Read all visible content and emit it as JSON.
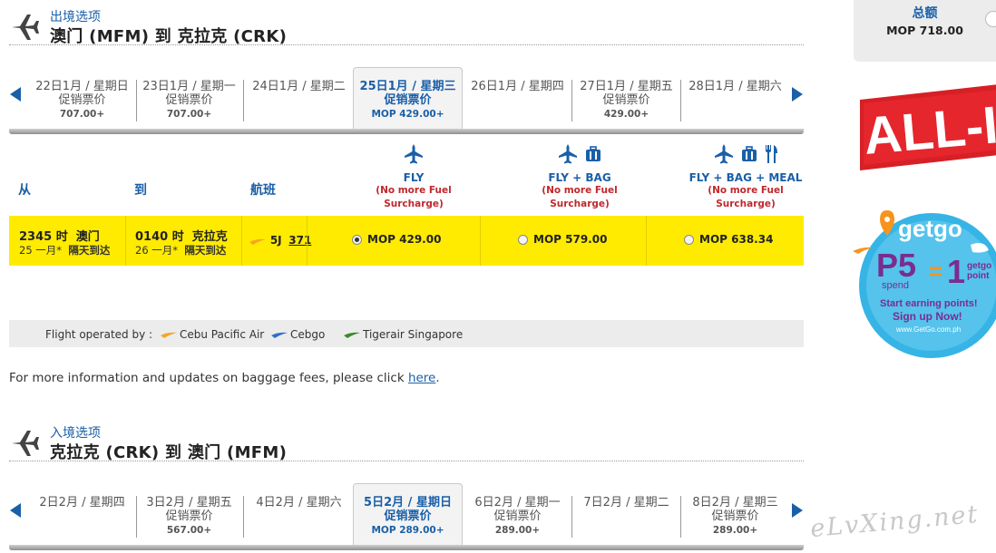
{
  "outbound": {
    "kicker": "出境选项",
    "route": "澳门 (MFM) 到 克拉克 (CRK)",
    "days": [
      {
        "date": "22日1月 / 星期日",
        "label": "促销票价",
        "price": "707.00+"
      },
      {
        "date": "23日1月 / 星期一",
        "label": "促销票价",
        "price": "707.00+"
      },
      {
        "date": "24日1月 / 星期二",
        "label": "",
        "price": ""
      },
      {
        "date": "25日1月 / 星期三",
        "label": "促销票价",
        "price": "MOP 429.00+"
      },
      {
        "date": "26日1月 / 星期四",
        "label": "",
        "price": ""
      },
      {
        "date": "27日1月 / 星期五",
        "label": "促销票价",
        "price": "429.00+"
      },
      {
        "date": "28日1月 / 星期六",
        "label": "",
        "price": ""
      }
    ]
  },
  "columns": {
    "from": "从",
    "to": "到",
    "flight": "航班",
    "fares": [
      {
        "name": "FLY",
        "note1": "(No more Fuel",
        "note2": "Surcharge)"
      },
      {
        "name": "FLY + BAG",
        "note1": "(No more Fuel",
        "note2": "Surcharge)"
      },
      {
        "name": "FLY + BAG + MEAL",
        "note1": "(No more Fuel",
        "note2": "Surcharge)"
      }
    ]
  },
  "flight": {
    "dep_time": "2345 时",
    "dep_city": "澳门",
    "dep_date": "25 一月*",
    "dep_arrival_note": "隔天到达",
    "arr_time": "0140 时",
    "arr_city": "克拉克",
    "arr_date": "26 一月*",
    "arr_arrival_note": "隔天到达",
    "code": "5J",
    "number": "371",
    "fares": [
      {
        "price": "MOP 429.00",
        "selected": true
      },
      {
        "price": "MOP 579.00",
        "selected": false
      },
      {
        "price": "MOP 638.34",
        "selected": false
      }
    ]
  },
  "operators": {
    "label": "Flight operated by :",
    "list": [
      {
        "name": "Cebu Pacific Air",
        "color": "#f5a623"
      },
      {
        "name": "Cebgo",
        "color": "#2f6fce"
      },
      {
        "name": "Tigerair Singapore",
        "color": "#3a8a2a"
      }
    ]
  },
  "info": {
    "text": "For more information and updates on baggage fees, please click ",
    "link": "here",
    "suffix": "."
  },
  "inbound": {
    "kicker": "入境选项",
    "route": "克拉克 (CRK) 到 澳门 (MFM)",
    "days": [
      {
        "date": "2日2月 / 星期四",
        "label": "",
        "price": ""
      },
      {
        "date": "3日2月 / 星期五",
        "label": "促销票价",
        "price": "567.00+"
      },
      {
        "date": "4日2月 / 星期六",
        "label": "",
        "price": ""
      },
      {
        "date": "5日2月 / 星期日",
        "label": "促销票价",
        "price": "MOP 289.00+"
      },
      {
        "date": "6日2月 / 星期一",
        "label": "促销票价",
        "price": "289.00+"
      },
      {
        "date": "7日2月 / 星期二",
        "label": "",
        "price": ""
      },
      {
        "date": "8日2月 / 星期三",
        "label": "促销票价",
        "price": "289.00+"
      }
    ]
  },
  "total": {
    "title": "总额",
    "value": "MOP  718.00"
  },
  "ads": {
    "allin": "ALL-IN",
    "getgo_brand": "getgo",
    "getgo_p5": "P5",
    "getgo_spend": "spend",
    "getgo_eq": "=",
    "getgo_one": "1",
    "getgo_unit1": "getgo",
    "getgo_unit2": "point",
    "getgo_line1": "Start earning points!",
    "getgo_line2": "Sign up Now!",
    "getgo_url": "www.GetGo.com.ph"
  },
  "watermark": "eLvXing.net",
  "colors": {
    "accent": "#1a5fa8",
    "highlight": "#ffeb00",
    "note": "#c0282d"
  }
}
